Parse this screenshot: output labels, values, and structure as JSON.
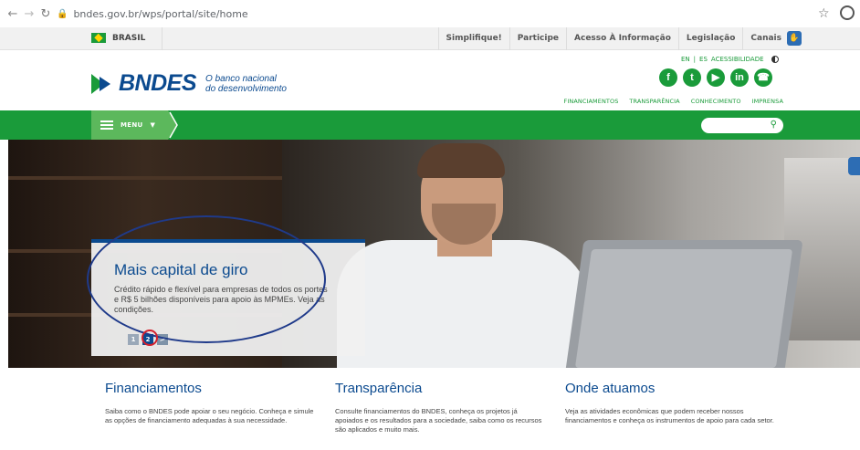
{
  "browser": {
    "url": "bndes.gov.br/wps/portal/site/home"
  },
  "govbar": {
    "brasil_label": "BRASIL",
    "links": [
      "Simplifique!",
      "Participe",
      "Acesso À Informação",
      "Legislação",
      "Canais"
    ]
  },
  "header": {
    "logo_text": "BNDES",
    "tagline_line1": "O banco nacional",
    "tagline_line2": "do desenvolvimento",
    "lang_en": "EN",
    "lang_sep": "|",
    "lang_es": "ES",
    "accessibility": "ACESSIBILIDADE",
    "socials": [
      "f",
      "t",
      "▶",
      "in",
      "☎"
    ],
    "nav": [
      "FINANCIAMENTOS",
      "TRANSPARÊNCIA",
      "CONHECIMENTO",
      "IMPRENSA"
    ]
  },
  "menu": {
    "label": "MENU",
    "search_placeholder": ""
  },
  "hero": {
    "title": "Mais capital de giro",
    "text": "Crédito rápido e flexível para empresas de todos os portes e R$ 5 bilhões disponíveis para apoio às MPMEs. Veja as condições.",
    "pages": [
      "1",
      "2"
    ],
    "next": ">",
    "active_page": 2
  },
  "sections": [
    {
      "title": "Financiamentos",
      "text": "Saiba como o BNDES pode apoiar o seu negócio. Conheça e simule as opções de financiamento adequadas à sua necessidade."
    },
    {
      "title": "Transparência",
      "text": "Consulte financiamentos do BNDES, conheça os projetos já apoiados e os resultados para a sociedade, saiba como os recursos são aplicados e muito mais."
    },
    {
      "title": "Onde atuamos",
      "text": "Veja as atividades econômicas que podem receber nossos financiamentos e conheça os instrumentos de apoio para cada setor."
    }
  ],
  "colors": {
    "brand_blue": "#0b4a8f",
    "brand_green": "#1a9b3a",
    "annotation_blue": "#1f3a8a",
    "annotation_red": "#d3202c"
  }
}
